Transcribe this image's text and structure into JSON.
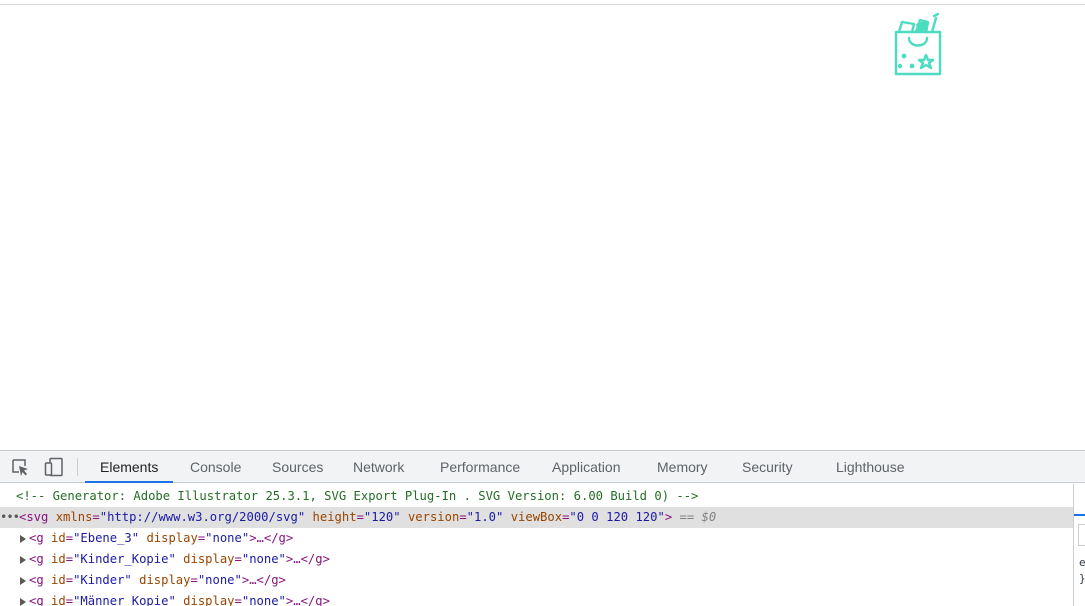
{
  "devtools": {
    "tabs": [
      "Elements",
      "Console",
      "Sources",
      "Network",
      "Performance",
      "Application",
      "Memory",
      "Security",
      "Lighthouse"
    ],
    "active_tab": "Elements"
  },
  "dom": {
    "comment": "<!-- Generator: Adobe Illustrator 25.3.1, SVG Export Plug-In . SVG Version: 6.00 Build 0) -->",
    "svg_line": {
      "tag_open": "<svg",
      "attrs": [
        {
          "name": "xmlns",
          "value": "\"http://www.w3.org/2000/svg\""
        },
        {
          "name": "height",
          "value": "\"120\""
        },
        {
          "name": "version",
          "value": "\"1.0\""
        },
        {
          "name": "viewBox",
          "value": "\"0 0 120 120\""
        }
      ],
      "tag_close": ">",
      "eq": "== $0"
    },
    "groups": [
      {
        "id": "\"Ebene_3\"",
        "display": "\"none\""
      },
      {
        "id": "\"Kinder_Kopie\"",
        "display": "\"none\""
      },
      {
        "id": "\"Kinder\"",
        "display": "\"none\""
      },
      {
        "id": "\"Männer_Kopie\"",
        "display": "\"none\""
      }
    ],
    "g_open": "<g",
    "id_attr": "id",
    "display_attr": "display",
    "ellipsis_close": ">…</g>"
  },
  "side": {
    "line1": "e",
    "line2": "}"
  },
  "colors": {
    "bag_icon": "#4cdcc0",
    "active_tab_underline": "#1a73e8"
  },
  "icons": [
    "shopping-bag-icon",
    "inspect-element-icon",
    "device-toggle-icon"
  ]
}
